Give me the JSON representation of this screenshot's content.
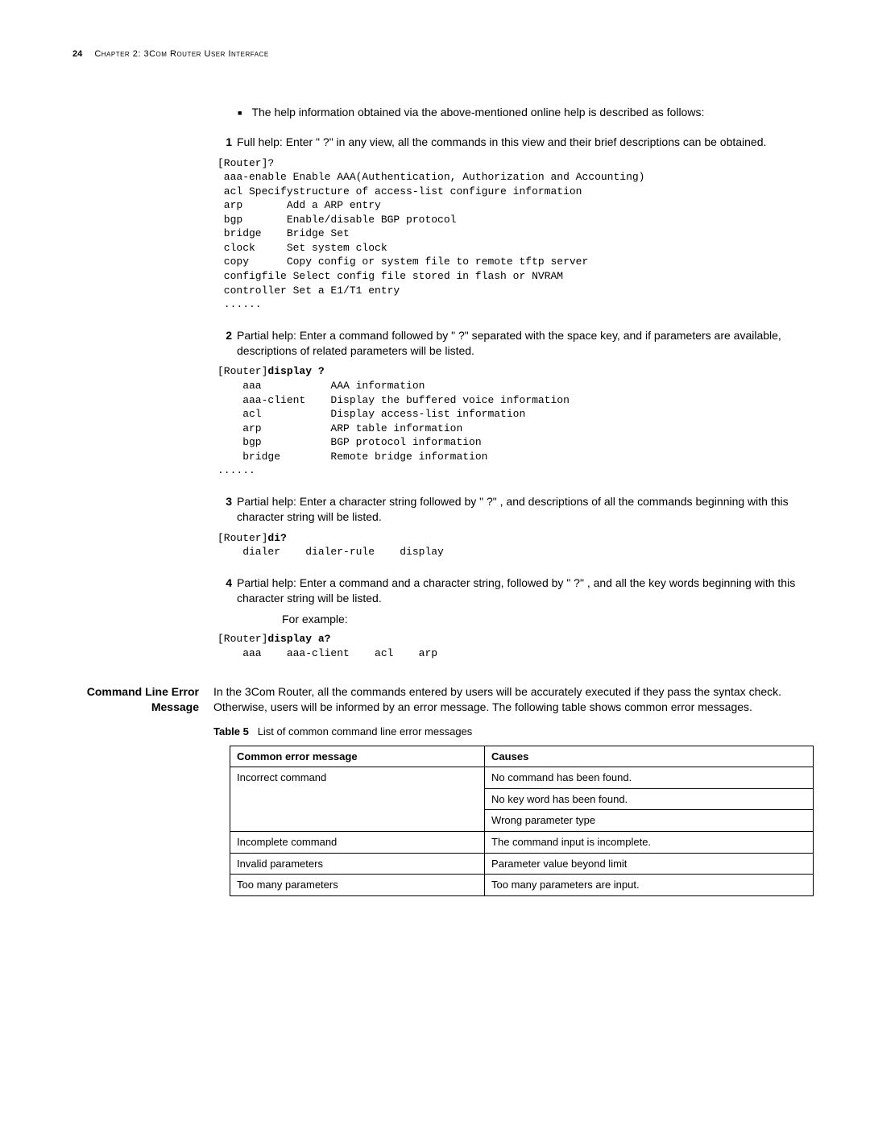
{
  "header": {
    "page_number": "24",
    "chapter_label": "Chapter 2: 3Com Router User Interface"
  },
  "bullet_intro": "The help information obtained via the above-mentioned online help is described as follows:",
  "items": {
    "i1": {
      "num": "1",
      "text": "Full help: Enter \" ?\"  in any view, all the commands in this view and their brief descriptions can be obtained.",
      "code": "[Router]?\n aaa-enable Enable AAA(Authentication, Authorization and Accounting)\n acl Specifystructure of access-list configure information\n arp       Add a ARP entry\n bgp       Enable/disable BGP protocol\n bridge    Bridge Set\n clock     Set system clock\n copy      Copy config or system file to remote tftp server\n configfile Select config file stored in flash or NVRAM\n controller Set a E1/T1 entry\n ......"
    },
    "i2": {
      "num": "2",
      "text": "Partial help: Enter a command followed by \" ?\"  separated with the space key, and if parameters are available, descriptions of related parameters will be listed.",
      "code_prefix": "[Router]",
      "code_bold": "display ?",
      "code_rest": "\n    aaa           AAA information\n    aaa-client    Display the buffered voice information\n    acl           Display access-list information\n    arp           ARP table information\n    bgp           BGP protocol information\n    bridge        Remote bridge information\n......"
    },
    "i3": {
      "num": "3",
      "text": "Partial help: Enter a character string followed by \" ?\" , and descriptions of all the commands beginning with this character string will be listed.",
      "code_prefix": "[Router]",
      "code_bold": "di?",
      "code_rest": "\n    dialer    dialer-rule    display"
    },
    "i4": {
      "num": "4",
      "text": "Partial help: Enter a command and a character string, followed by \" ?\" , and all the key words beginning with this character string will be listed.",
      "for_example": "For example:",
      "code_prefix": "[Router]",
      "code_bold": "display a?",
      "code_rest": "\n    aaa    aaa-client    acl    arp"
    }
  },
  "side_section": {
    "label_line1": "Command Line Error",
    "label_line2": "Message",
    "para": "In the 3Com Router, all the commands entered by users will be accurately executed if they pass the syntax check. Otherwise, users will be informed by an error message. The following table shows common error messages.",
    "table_caption_label": "Table 5",
    "table_caption_text": "List of common command line error messages",
    "table": {
      "head_col1": "Common error message",
      "head_col2": "Causes",
      "rows": {
        "r1c1": "Incorrect command",
        "r1c2a": "No command has been found.",
        "r1c2b": "No key word has been found.",
        "r1c2c": "Wrong parameter type",
        "r2c1": "Incomplete command",
        "r2c2": "The command input is incomplete.",
        "r3c1": "Invalid parameters",
        "r3c2": "Parameter value beyond limit",
        "r4c1": "Too many parameters",
        "r4c2": "Too many parameters are input."
      }
    }
  }
}
